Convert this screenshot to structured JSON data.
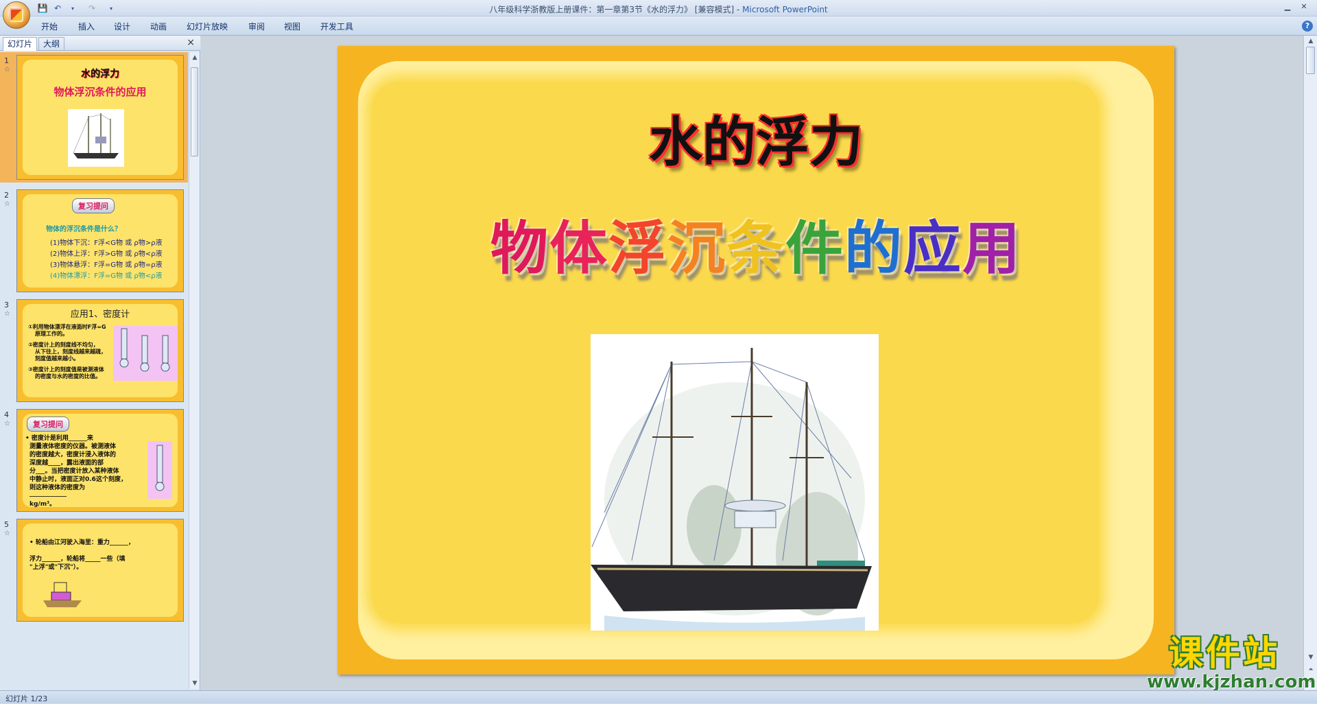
{
  "window": {
    "title_doc": "八年级科学浙教版上册课件：第一章第3节《水的浮力》 [兼容模式] - ",
    "title_app": "Microsoft PowerPoint"
  },
  "ribbon": {
    "tabs": [
      "开始",
      "插入",
      "设计",
      "动画",
      "幻灯片放映",
      "审阅",
      "视图",
      "开发工具"
    ]
  },
  "pane": {
    "tab_slides": "幻灯片",
    "tab_outline": "大纲",
    "close": "×"
  },
  "thumbnails": [
    {
      "num": "1",
      "title": "水的浮力",
      "subtitle": "物体浮沉条件的应用"
    },
    {
      "num": "2",
      "badge": "复习提问",
      "question": "物体的浮沉条件是什么？",
      "lines": [
        "(1)物体下沉：F浮<G物 或 ρ物>ρ液",
        "(2)物体上浮：F浮>G物 或 ρ物<ρ液",
        "(3)物体悬浮：F浮=G物 或 ρ物=ρ液",
        "(4)物体漂浮：F浮=G物 或 ρ物<ρ液"
      ]
    },
    {
      "num": "3",
      "title": "应用1、密度计",
      "lines": [
        "①利用物体漂浮在液面时F浮=G",
        "原理工作的。",
        "②密度计上的刻度线不均匀，",
        "从下往上，刻度线越来越疏，",
        "刻度值越来越小。",
        "③密度计上的刻度值是被测液体",
        "的密度与水的密度的比值。"
      ]
    },
    {
      "num": "4",
      "badge": "复习提问",
      "lines": [
        "• 密度计是利用______来",
        "测量液体密度的仪器。被测液体",
        "的密度越大，密度计浸入液体的",
        "深度越____，露出液面的部",
        "分___。当把密度计放入某种液体",
        "中静止时，液面正对0.6这个刻度，",
        "则这种液体的密度为",
        "____________",
        "kg/m³。"
      ]
    },
    {
      "num": "5",
      "lines": [
        "• 轮船由江河驶入海里：重力______，",
        "浮力______，轮船将_____一些（填",
        "\"上浮\"或\"下沉\"）。"
      ]
    }
  ],
  "slide": {
    "title": "水的浮力",
    "subtitle_chars": [
      {
        "ch": "物",
        "color": "#e0195a"
      },
      {
        "ch": "体",
        "color": "#e8235a"
      },
      {
        "ch": "浮",
        "color": "#f2452c"
      },
      {
        "ch": "沉",
        "color": "#f58220"
      },
      {
        "ch": "条",
        "color": "#f0c21e"
      },
      {
        "ch": "件",
        "color": "#3aa33a"
      },
      {
        "ch": "的",
        "color": "#1e6fd0"
      },
      {
        "ch": "应",
        "color": "#4a2fc4"
      },
      {
        "ch": "用",
        "color": "#a020a8"
      }
    ]
  },
  "watermark": {
    "cn": "课件站",
    "url": "www.kjzhan.com"
  },
  "status": {
    "slide_counter": "幻灯片 1/23"
  }
}
